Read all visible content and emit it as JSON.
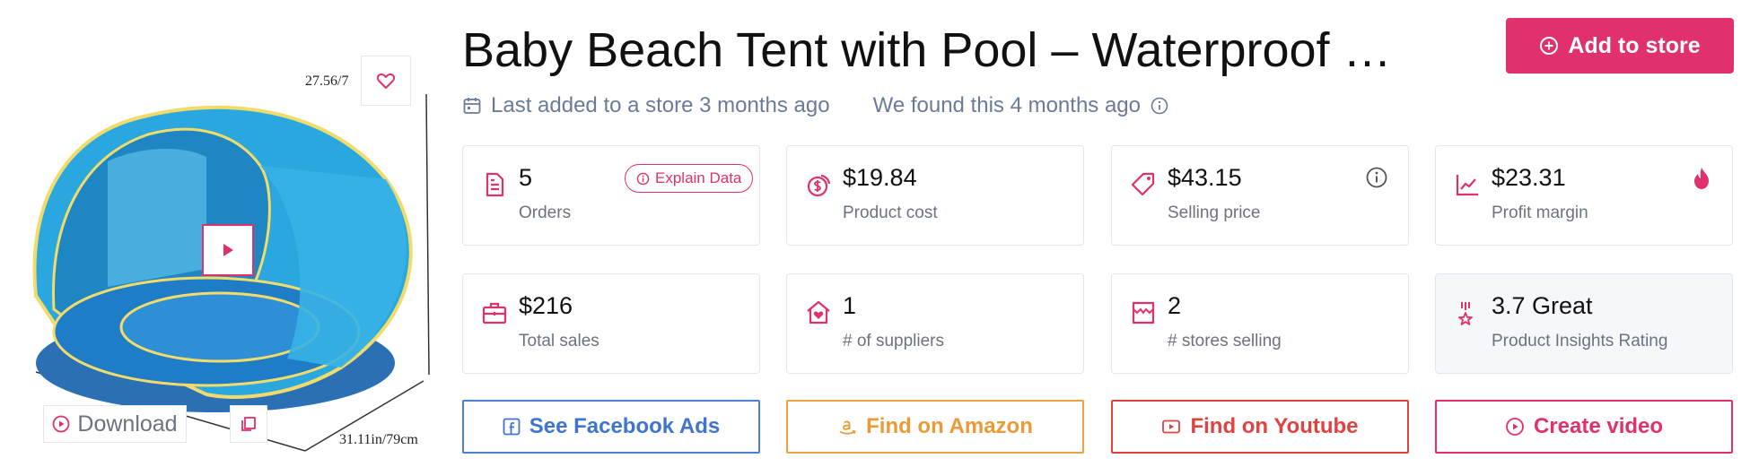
{
  "product": {
    "title": "Baby Beach Tent with Pool – Waterproof …",
    "dim_top": "27.56/7",
    "dim_bottom": "31.11in/79cm"
  },
  "image_actions": {
    "download_label": "Download"
  },
  "header": {
    "add_to_store_label": "Add to store",
    "last_added": "Last added to a store 3 months ago",
    "found": "We found this 4 months ago"
  },
  "stats": {
    "orders": {
      "value": "5",
      "label": "Orders",
      "explain_label": "Explain Data"
    },
    "product_cost": {
      "value": "$19.84",
      "label": "Product cost"
    },
    "selling_price": {
      "value": "$43.15",
      "label": "Selling price"
    },
    "profit_margin": {
      "value": "$23.31",
      "label": "Profit margin"
    },
    "total_sales": {
      "value": "$216",
      "label": "Total sales"
    },
    "suppliers": {
      "value": "1",
      "label": "# of suppliers"
    },
    "stores_selling": {
      "value": "2",
      "label": "# stores selling"
    },
    "rating": {
      "value": "3.7 Great",
      "label": "Product Insights Rating"
    }
  },
  "actions": {
    "facebook_label": "See Facebook Ads",
    "amazon_label": "Find on Amazon",
    "youtube_label": "Find on Youtube",
    "video_label": "Create video"
  },
  "colors": {
    "accent": "#e0306d",
    "facebook": "#3f74d0",
    "amazon": "#ec9a35",
    "youtube": "#e0423f",
    "muted": "#6b7a99"
  }
}
